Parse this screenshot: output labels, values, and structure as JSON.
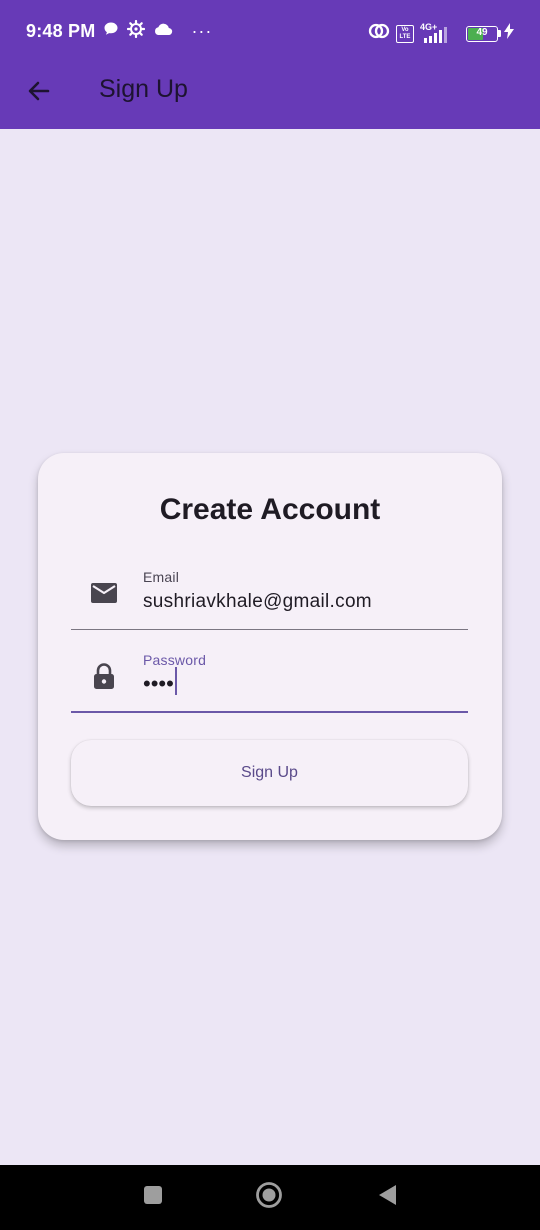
{
  "status_bar": {
    "time": "9:48 PM",
    "battery_level": "49",
    "network": "4G+",
    "volte": "Vo LTE",
    "more_indicator": "···",
    "icons": [
      "chat-bubble-icon",
      "settings-cog-icon",
      "cloud-icon",
      "hotspot-icon",
      "volte-icon",
      "signal-icon",
      "battery-icon",
      "charging-icon"
    ]
  },
  "app_bar": {
    "title": "Sign Up",
    "back_icon": "arrow-back-icon"
  },
  "card": {
    "title": "Create Account",
    "email": {
      "label": "Email",
      "value": "sushriavkhale@gmail.com",
      "icon": "mail-icon"
    },
    "password": {
      "label": "Password",
      "value": "••••",
      "icon": "lock-icon"
    },
    "signup_button": "Sign Up"
  },
  "nav_bar": {
    "icons": [
      "recents-icon",
      "home-icon",
      "back-triangle-icon"
    ]
  },
  "colors": {
    "primary": "#673ab7",
    "background": "#ece6f5",
    "card": "#f6f0f8",
    "accent": "#6b58a8"
  }
}
